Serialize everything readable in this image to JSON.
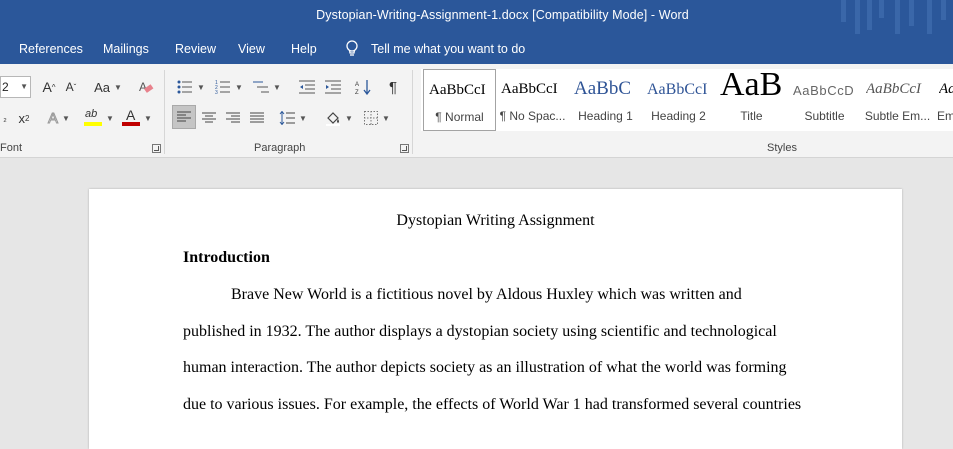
{
  "window": {
    "title": "Dystopian-Writing-Assignment-1.docx [Compatibility Mode]  -  Word"
  },
  "menu": {
    "tabs": [
      "References",
      "Mailings",
      "Review",
      "View",
      "Help"
    ],
    "tell_me": "Tell me what you want to do",
    "tell_icon": "lightbulb-icon"
  },
  "ribbon": {
    "font_size": "2",
    "font_group_label": "Font",
    "paragraph_group_label": "Paragraph",
    "styles_group_label": "Styles",
    "font_buttons": {
      "grow": "A",
      "shrink": "A",
      "change_case": "Aa",
      "highlight_text": "ab",
      "font_color_text": "A",
      "text_effects": "A",
      "subscript": "x",
      "superscript": "x",
      "pilcrow": "¶"
    },
    "colors": {
      "highlight": "#ffff00",
      "font_color": "#c00000",
      "accent": "#2b579a"
    },
    "styles": [
      {
        "sample": "AaBbCcI",
        "name": "¶ Normal"
      },
      {
        "sample": "AaBbCcI",
        "name": "¶ No Spac..."
      },
      {
        "sample": "AaBbC",
        "name": "Heading 1"
      },
      {
        "sample": "AaBbCcI",
        "name": "Heading 2"
      },
      {
        "sample": "AaB",
        "name": "Title"
      },
      {
        "sample": "AaBbCcD",
        "name": "Subtitle"
      },
      {
        "sample": "AaBbCcI",
        "name": "Subtle Em..."
      },
      {
        "sample": "AaBbCcI",
        "name": "Em"
      }
    ]
  },
  "document": {
    "title": "Dystopian Writing Assignment",
    "heading": "Introduction",
    "lines": [
      "Brave New World is a fictitious novel by Aldous Huxley which was written and",
      "published in 1932. The author displays a dystopian society using scientific and technological",
      "human interaction. The author depicts society as an illustration of what the world was forming",
      "due to various issues. For example, the effects of World War 1 had transformed several countries"
    ]
  }
}
